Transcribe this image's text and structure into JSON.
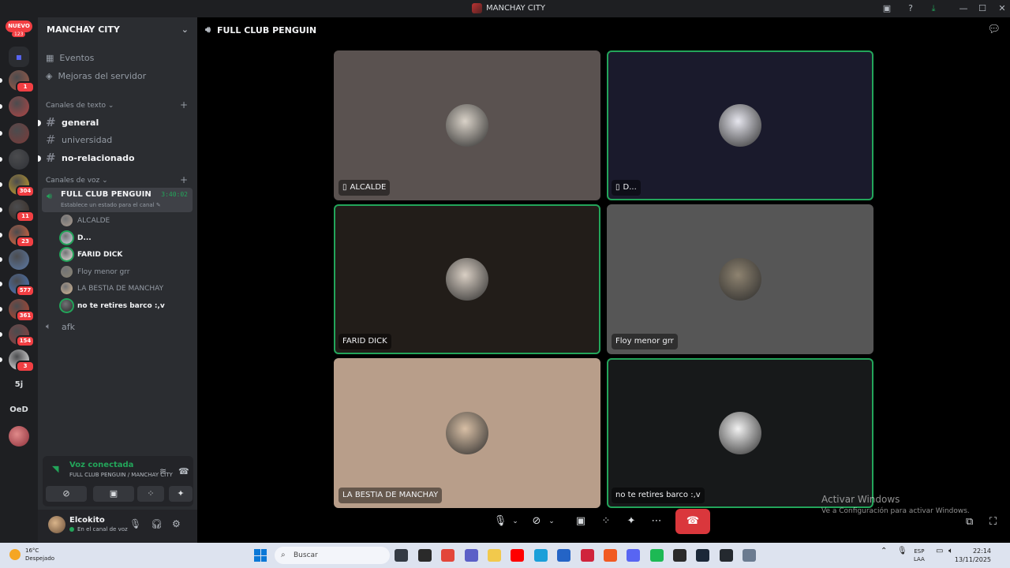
{
  "window": {
    "title": "MANCHAY CITY",
    "controls": {
      "minimize": "—",
      "maximize": "☐",
      "close": "✕"
    }
  },
  "rail": {
    "new_badge": "NUEVO",
    "new_count": "123",
    "servers": [
      {
        "badge": "1",
        "color": "#a35b45"
      },
      {
        "badge": "",
        "color": "#b24545"
      },
      {
        "badge": "",
        "color": "#7b3a38"
      },
      {
        "badge": "",
        "color": "#2f3136"
      },
      {
        "badge": "304",
        "color": "#c9a227"
      },
      {
        "badge": "11",
        "color": "#3a2d24"
      },
      {
        "badge": "23",
        "color": "#e8663c"
      },
      {
        "badge": "",
        "color": "#5c7aa6"
      },
      {
        "badge": "577",
        "color": "#4a78c2"
      },
      {
        "badge": "361",
        "color": "#b8452f"
      },
      {
        "badge": "154",
        "color": "#914040"
      },
      {
        "badge": "3",
        "color": "#f0f0f0"
      }
    ],
    "text_servers": [
      "5j",
      "OeD"
    ]
  },
  "sidebar": {
    "server_name": "MANCHAY CITY",
    "events": "Eventos",
    "boosts": "Mejoras del servidor",
    "text_category": "Canales de texto",
    "voice_category": "Canales de voz",
    "text_channels": [
      {
        "name": "general",
        "unread": true
      },
      {
        "name": "universidad",
        "unread": false
      },
      {
        "name": "no-relacionado",
        "unread": true
      }
    ],
    "voice_channel": {
      "name": "FULL CLUB PENGUIN",
      "timer": "3:40:02",
      "status": "Establece un estado para el canal"
    },
    "members": [
      {
        "name": "ALCALDE",
        "speaking": false,
        "bright": false,
        "color": "#a99a8e"
      },
      {
        "name": "D...",
        "speaking": true,
        "bright": true,
        "color": "#cfd3e0"
      },
      {
        "name": "FARID DICK",
        "speaking": true,
        "bright": true,
        "color": "#e6e1da"
      },
      {
        "name": "Floy menor grr",
        "speaking": false,
        "bright": false,
        "color": "#8a8372"
      },
      {
        "name": "LA BESTIA DE MANCHAY",
        "speaking": false,
        "bright": false,
        "color": "#d6b894"
      },
      {
        "name": "no te retires barco :,v",
        "speaking": true,
        "bright": true,
        "color": "#2a2a2a"
      }
    ],
    "afk_channel": "afk"
  },
  "voice_panel": {
    "title": "Voz conectada",
    "subtitle": "FULL CLUB PENGUIN / MANCHAY CITY"
  },
  "user": {
    "name": "Elcokito",
    "status": "En el canal de voz"
  },
  "stage": {
    "channel_title": "FULL CLUB PENGUIN",
    "tiles": [
      {
        "name": "ALCALDE",
        "speaking": false,
        "mobile": true,
        "bg": "#5a5250",
        "av": "#d9d2c8"
      },
      {
        "name": "D...",
        "speaking": true,
        "mobile": true,
        "bg": "#1a1a2c",
        "av": "#e6e6ee"
      },
      {
        "name": "FARID DICK",
        "speaking": true,
        "mobile": false,
        "bg": "#221d19",
        "av": "#d9cfc4"
      },
      {
        "name": "Floy menor grr",
        "speaking": false,
        "mobile": false,
        "bg": "#565656",
        "av": "#8e8370"
      },
      {
        "name": "LA BESTIA DE MANCHAY",
        "speaking": false,
        "mobile": false,
        "bg": "#b89e8a",
        "av": "#d8bfa5"
      },
      {
        "name": "no te retires barco :,v",
        "speaking": true,
        "mobile": false,
        "bg": "#17191a",
        "av": "#f2f2f2"
      }
    ]
  },
  "activation": {
    "line1": "Activar Windows",
    "line2": "Ve a Configuración para activar Windows."
  },
  "taskbar": {
    "temperature": "16°C",
    "weather": "Despejado",
    "search_placeholder": "Buscar",
    "lang_top": "ESP",
    "lang_bottom": "LAA",
    "time": "22:14",
    "date": "13/11/2025",
    "apps": [
      {
        "name": "task-view",
        "color": "#333a44"
      },
      {
        "name": "epic-games",
        "color": "#2a2a2a"
      },
      {
        "name": "chrome",
        "color": "#e3463a"
      },
      {
        "name": "teams",
        "color": "#5b5fc7"
      },
      {
        "name": "file-explorer",
        "color": "#f2c94c"
      },
      {
        "name": "youtube",
        "color": "#ff0000"
      },
      {
        "name": "edge",
        "color": "#1a9fd9"
      },
      {
        "name": "store",
        "color": "#2464c6"
      },
      {
        "name": "opera",
        "color": "#d0243c"
      },
      {
        "name": "brave",
        "color": "#f15a22"
      },
      {
        "name": "discord",
        "color": "#5865f2"
      },
      {
        "name": "spotify",
        "color": "#1db954"
      },
      {
        "name": "epic-games-2",
        "color": "#2a2a2a"
      },
      {
        "name": "steam",
        "color": "#1b2838"
      },
      {
        "name": "github",
        "color": "#24292f"
      },
      {
        "name": "settings",
        "color": "#6b7b90"
      }
    ]
  },
  "colors": {
    "accent_green": "#23a55a",
    "hangup_red": "#da373c",
    "badge_red": "#f23f43"
  }
}
